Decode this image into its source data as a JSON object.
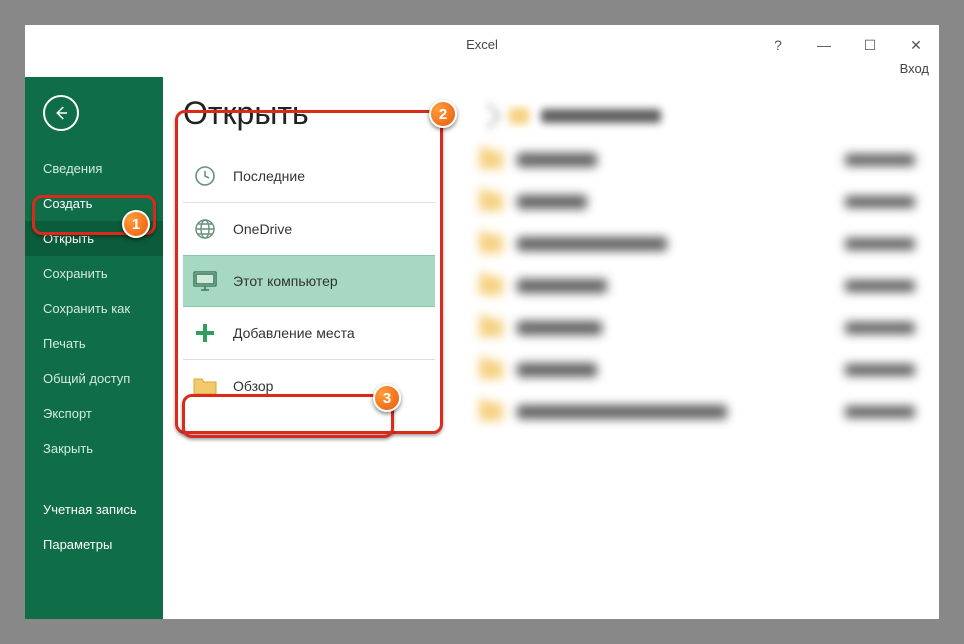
{
  "app": {
    "title": "Excel",
    "login": "Вход"
  },
  "window_controls": {
    "help": "?",
    "minimize": "—",
    "maximize": "☐",
    "close": "✕"
  },
  "sidebar": {
    "items": [
      {
        "label": "Сведения"
      },
      {
        "label": "Создать"
      },
      {
        "label": "Открыть"
      },
      {
        "label": "Сохранить"
      },
      {
        "label": "Сохранить как"
      },
      {
        "label": "Печать"
      },
      {
        "label": "Общий доступ"
      },
      {
        "label": "Экспорт"
      },
      {
        "label": "Закрыть"
      }
    ],
    "footer": [
      {
        "label": "Учетная запись"
      },
      {
        "label": "Параметры"
      }
    ]
  },
  "open": {
    "title": "Открыть",
    "locations": [
      {
        "label": "Последние",
        "icon": "clock"
      },
      {
        "label": "OneDrive",
        "icon": "globe"
      },
      {
        "label": "Этот компьютер",
        "icon": "computer"
      },
      {
        "label": "Добавление места",
        "icon": "plus"
      },
      {
        "label": "Обзор",
        "icon": "folder"
      }
    ]
  },
  "files": {
    "rows": [
      {
        "nameWidth": 80
      },
      {
        "nameWidth": 70
      },
      {
        "nameWidth": 150
      },
      {
        "nameWidth": 90
      },
      {
        "nameWidth": 85
      },
      {
        "nameWidth": 80
      },
      {
        "nameWidth": 210
      }
    ]
  },
  "callouts": {
    "b1": "1",
    "b2": "2",
    "b3": "3"
  }
}
